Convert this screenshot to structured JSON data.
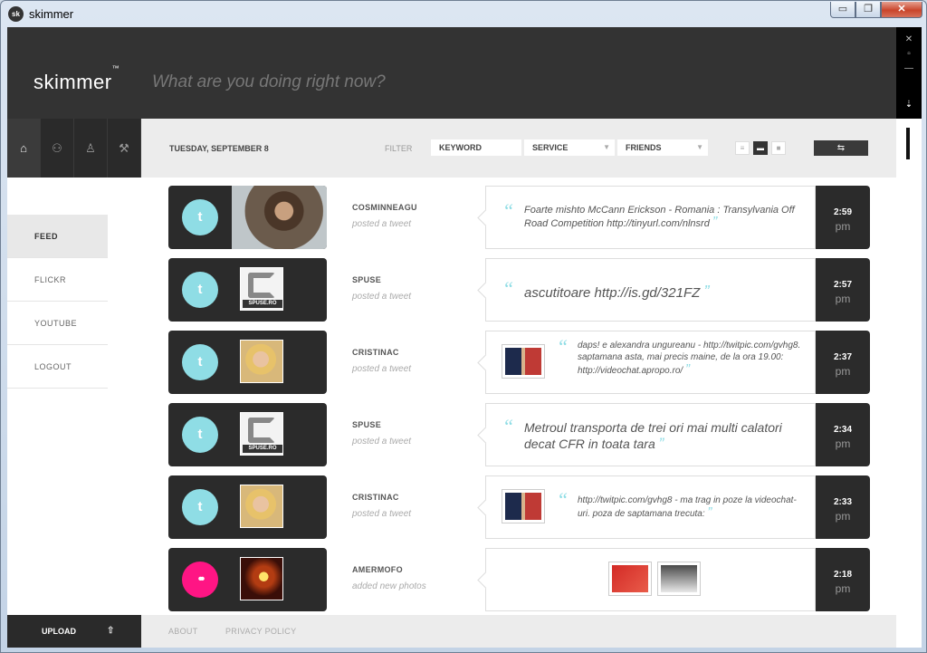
{
  "window": {
    "title": "skimmer",
    "app_icon": "sk",
    "min_label": "▭",
    "max_label": "❐",
    "close_label": "✕"
  },
  "app": {
    "logo": "skimmer",
    "logo_mark": "™",
    "status_placeholder": "What are you doing right now?"
  },
  "side_controls": [
    "✕",
    "▫",
    "—",
    "⇣"
  ],
  "nav_icons": [
    "home-icon",
    "friends-icon",
    "person-icon",
    "wrench-icon"
  ],
  "toolbar": {
    "date": "TUESDAY, SEPTEMBER 8",
    "filter_label": "FILTER",
    "keyword": "KEYWORD",
    "service": "SERVICE",
    "friends": "FRIENDS",
    "refresh_icon": "⇆"
  },
  "menu": [
    {
      "label": "FEED",
      "active": true
    },
    {
      "label": "FLICKR",
      "active": false
    },
    {
      "label": "YOUTUBE",
      "active": false
    },
    {
      "label": "LOGOUT",
      "active": false
    }
  ],
  "feed": [
    {
      "service": "t",
      "user": "COSMINNEAGU",
      "action": "posted a tweet",
      "pre": "Foarte mishto McCann Erickson - Romania : Transylvania Off Road Competition ",
      "link": "http://tinyurl.com/nlnsrd",
      "post": "",
      "time": "2:59",
      "ampm": "pm"
    },
    {
      "service": "t",
      "user": "SPUSE",
      "action": "posted a tweet",
      "pre": "ascutitoare ",
      "link": "http://is.gd/321FZ",
      "post": "",
      "time": "2:57",
      "ampm": "pm",
      "avatar_text": "SPUSE.RO"
    },
    {
      "service": "t",
      "user": "CRISTINAC",
      "action": "posted a tweet",
      "pre": "daps! e alexandra ungureanu - ",
      "link": "http://twitpic.com/gvhg8",
      "mid": ". saptamana asta, mai precis maine, de la ora 19.00: ",
      "link2": "http://videochat.apropo.ro/",
      "time": "2:37",
      "ampm": "pm"
    },
    {
      "service": "t",
      "user": "SPUSE",
      "action": "posted a tweet",
      "pre": "Metroul transporta de trei ori mai multi calatori decat CFR in toata tara",
      "link": "",
      "post": "",
      "time": "2:34",
      "ampm": "pm",
      "avatar_text": "SPUSE.RO"
    },
    {
      "service": "t",
      "user": "CRISTINAC",
      "action": "posted a tweet",
      "pre": "",
      "link": "http://twitpic.com/gvhg8",
      "post": " - ma trag in poze la videochat-uri. poza de saptamana trecuta:",
      "time": "2:33",
      "ampm": "pm"
    },
    {
      "service": "••",
      "user": "AMERMOFO",
      "action": "added new photos",
      "time": "2:18",
      "ampm": "pm"
    }
  ],
  "quote_open": "“",
  "quote_close": "”",
  "footer": {
    "upload": "UPLOAD",
    "upload_icon": "⇧",
    "about": "ABOUT",
    "privacy": "PRIVACY POLICY"
  },
  "colors": {
    "dark": "#333333",
    "twitter": "#8fdde5",
    "flickr": "#ff1584"
  }
}
